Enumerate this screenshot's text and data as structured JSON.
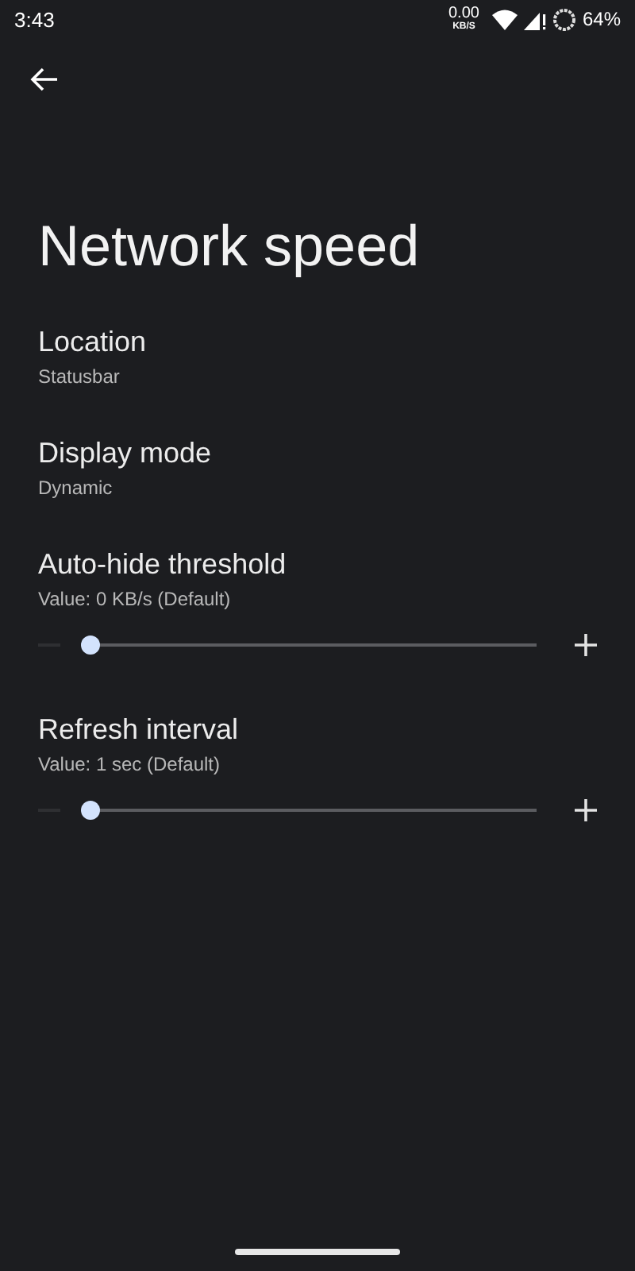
{
  "status_bar": {
    "time": "3:43",
    "speed_value": "0.00",
    "speed_unit": "KB/S",
    "battery": "64%"
  },
  "title": "Network speed",
  "settings": [
    {
      "kind": "list",
      "title": "Location",
      "summary": "Statusbar"
    },
    {
      "kind": "list",
      "title": "Display mode",
      "summary": "Dynamic"
    },
    {
      "kind": "slider",
      "title": "Auto-hide threshold",
      "summary": "Value: 0 KB/s (Default)",
      "level": 0,
      "decrease_disabled": true
    },
    {
      "kind": "slider",
      "title": "Refresh interval",
      "summary": "Value: 1 sec (Default)",
      "level": 0,
      "decrease_disabled": true
    }
  ]
}
